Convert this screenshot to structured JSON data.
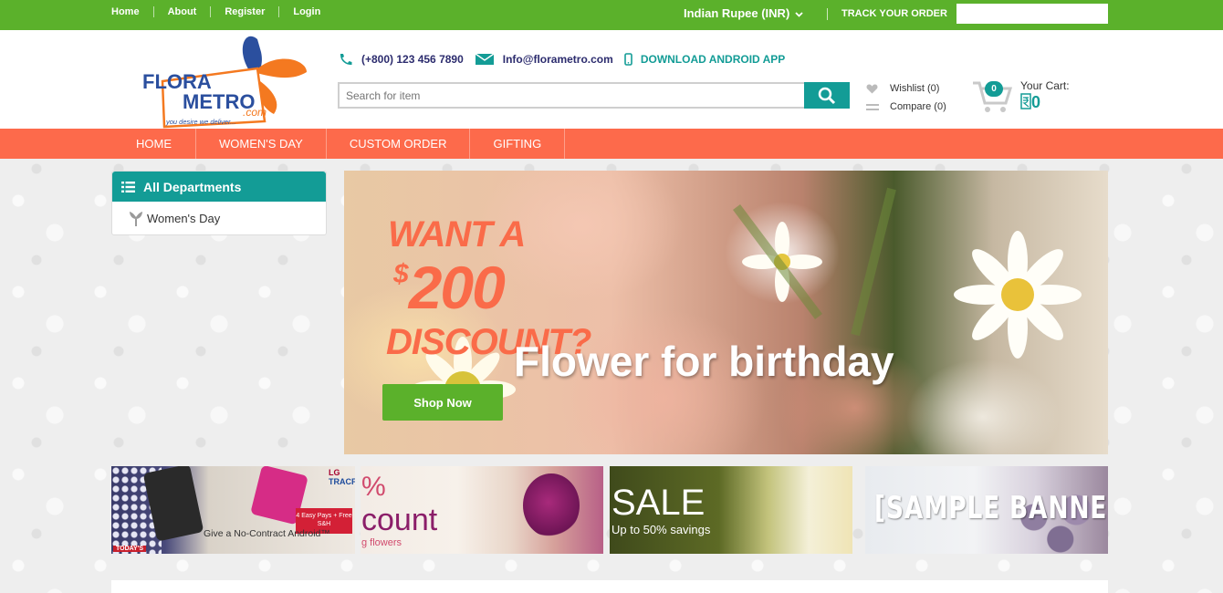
{
  "topbar": {
    "links": [
      "Home",
      "About",
      "Register",
      "Login"
    ],
    "currency": "Indian Rupee (INR)",
    "track_label": "TRACK YOUR ORDER",
    "track_value": ""
  },
  "logo": {
    "line1": "FLORA",
    "line2": "METRO",
    "com": ".com",
    "tagline": "you desire we deliver..."
  },
  "contact": {
    "phone": "(+800) 123 456 7890",
    "email": "Info@florametro.com",
    "app": "DOWNLOAD ANDROID APP"
  },
  "search": {
    "placeholder": "Search for item"
  },
  "account": {
    "wishlist": "Wishlist (0)",
    "compare": "Compare (0)"
  },
  "cart": {
    "count": "0",
    "label": "Your Cart:",
    "amount": "0"
  },
  "nav": {
    "items": [
      "HOME",
      "WOMEN'S DAY",
      "CUSTOM ORDER",
      "GIFTING"
    ]
  },
  "departments": {
    "title": "All Departments",
    "items": [
      "Women's Day"
    ]
  },
  "hero": {
    "line1": "WANT A",
    "currency_symbol": "$",
    "amount": "200",
    "line3": "DISCOUNT?",
    "headline": "Flower for birthday",
    "button": "Shop Now"
  },
  "banners": {
    "b1": {
      "brand": "LG",
      "carrier": "TRACFONE",
      "offer": "4 Easy Pays + Free S&H",
      "caption": "Give a No-Contract Android™",
      "tag": "TODAY'S"
    },
    "b2": {
      "pct": "%",
      "text": "count",
      "sub": "g flowers"
    },
    "b3": {
      "title": "SALE",
      "sub": "Up to 50% savings"
    },
    "b4": {
      "title": "[SAMPLE BANNER]"
    }
  },
  "colors": {
    "topbar": "#5bb12b",
    "accent": "#139c96",
    "nav": "#fd6a4b",
    "hero_text": "#fa6b49"
  }
}
